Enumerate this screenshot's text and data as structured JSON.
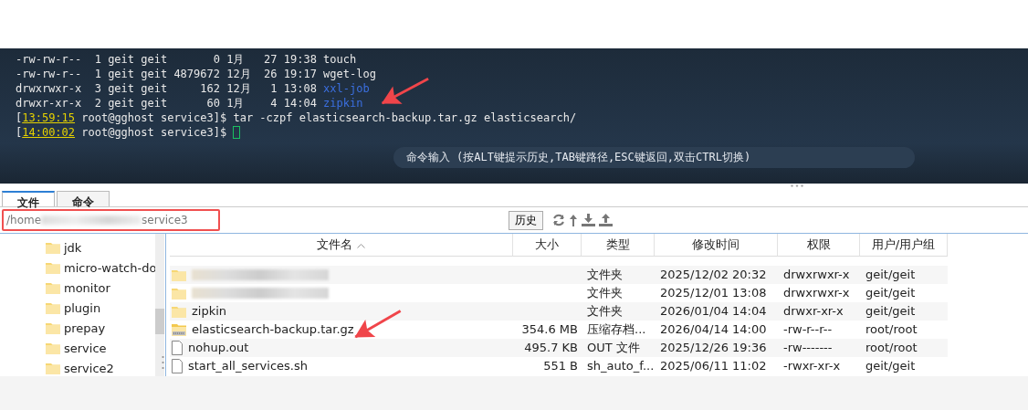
{
  "terminal": {
    "lines": [
      {
        "kind": "listing",
        "text": "-rw-rw-r--  1 geit geit       0 1月   27 19:38 ",
        "name": "touch",
        "is_dir": false
      },
      {
        "kind": "listing",
        "text": "-rw-rw-r--  1 geit geit 4879672 12月  26 19:17 ",
        "name": "wget-log",
        "is_dir": false
      },
      {
        "kind": "listing",
        "text": "drwxrwxr-x  3 geit geit     162 12月   1 13:08 ",
        "name": "xxl-job",
        "is_dir": true
      },
      {
        "kind": "listing",
        "text": "drwxr-xr-x  2 geit geit      60 1月    4 14:04 ",
        "name": "zipkin",
        "is_dir": true
      },
      {
        "kind": "prompt",
        "bracket": "[",
        "time": "13:59:15",
        "prompt": "root@gghost service3]$ ",
        "command": "tar -czpf elasticsearch-backup.tar.gz elasticsearch/"
      },
      {
        "kind": "prompt",
        "bracket": "[",
        "time": "14:00:02",
        "prompt": "root@gghost service3]$ ",
        "cursor": true
      }
    ],
    "hint": "命令输入 (按ALT键提示历史,TAB键路径,ESC键返回,双击CTRL切换)"
  },
  "tabs": [
    {
      "label": "文件",
      "selected": true
    },
    {
      "label": "命令",
      "selected": false
    }
  ],
  "path": {
    "start": "/home",
    "end": "service3"
  },
  "history_button": "历史",
  "tree": [
    "jdk",
    "micro-watch-do",
    "monitor",
    "plugin",
    "prepay",
    "service",
    "service2"
  ],
  "table": {
    "columns": [
      {
        "label": "文件名",
        "sorted": true
      },
      {
        "label": "大小",
        "sorted": false
      },
      {
        "label": "类型",
        "sorted": false
      },
      {
        "label": "修改时间",
        "sorted": false
      },
      {
        "label": "权限",
        "sorted": false
      },
      {
        "label": "用户/用户组",
        "sorted": false
      }
    ],
    "rows": [
      {
        "kind": "folder",
        "name_hidden": true,
        "type": "文件夹",
        "mtime": "2025/12/02 20:32",
        "perm": "drwxrwxr-x",
        "owner": "geit/geit"
      },
      {
        "kind": "folder",
        "name_hidden": true,
        "type": "文件夹",
        "mtime": "2025/12/01 13:08",
        "perm": "drwxrwxr-x",
        "owner": "geit/geit"
      },
      {
        "kind": "folder",
        "name_hidden": false,
        "name": "zipkin",
        "type": "文件夹",
        "mtime": "2026/01/04 14:04",
        "perm": "drwxr-xr-x",
        "owner": "geit/geit"
      },
      {
        "kind": "archive",
        "name_hidden": false,
        "name": "elasticsearch-backup.tar.gz",
        "size": "354.6 MB",
        "type": "压缩存档...",
        "mtime": "2026/04/14 14:00",
        "perm": "-rw-r--r--",
        "owner": "root/root"
      },
      {
        "kind": "file",
        "name_hidden": false,
        "name": "nohup.out",
        "size": "495.7 KB",
        "type": "OUT 文件",
        "mtime": "2025/12/26 19:36",
        "perm": "-rw-------",
        "owner": "root/root"
      },
      {
        "kind": "file",
        "name_hidden": false,
        "name": "start_all_services.sh",
        "size": "551 B",
        "type": "sh_auto_f...",
        "mtime": "2025/06/11 11:02",
        "perm": "-rwxr-xr-x",
        "owner": "geit/geit"
      }
    ]
  }
}
